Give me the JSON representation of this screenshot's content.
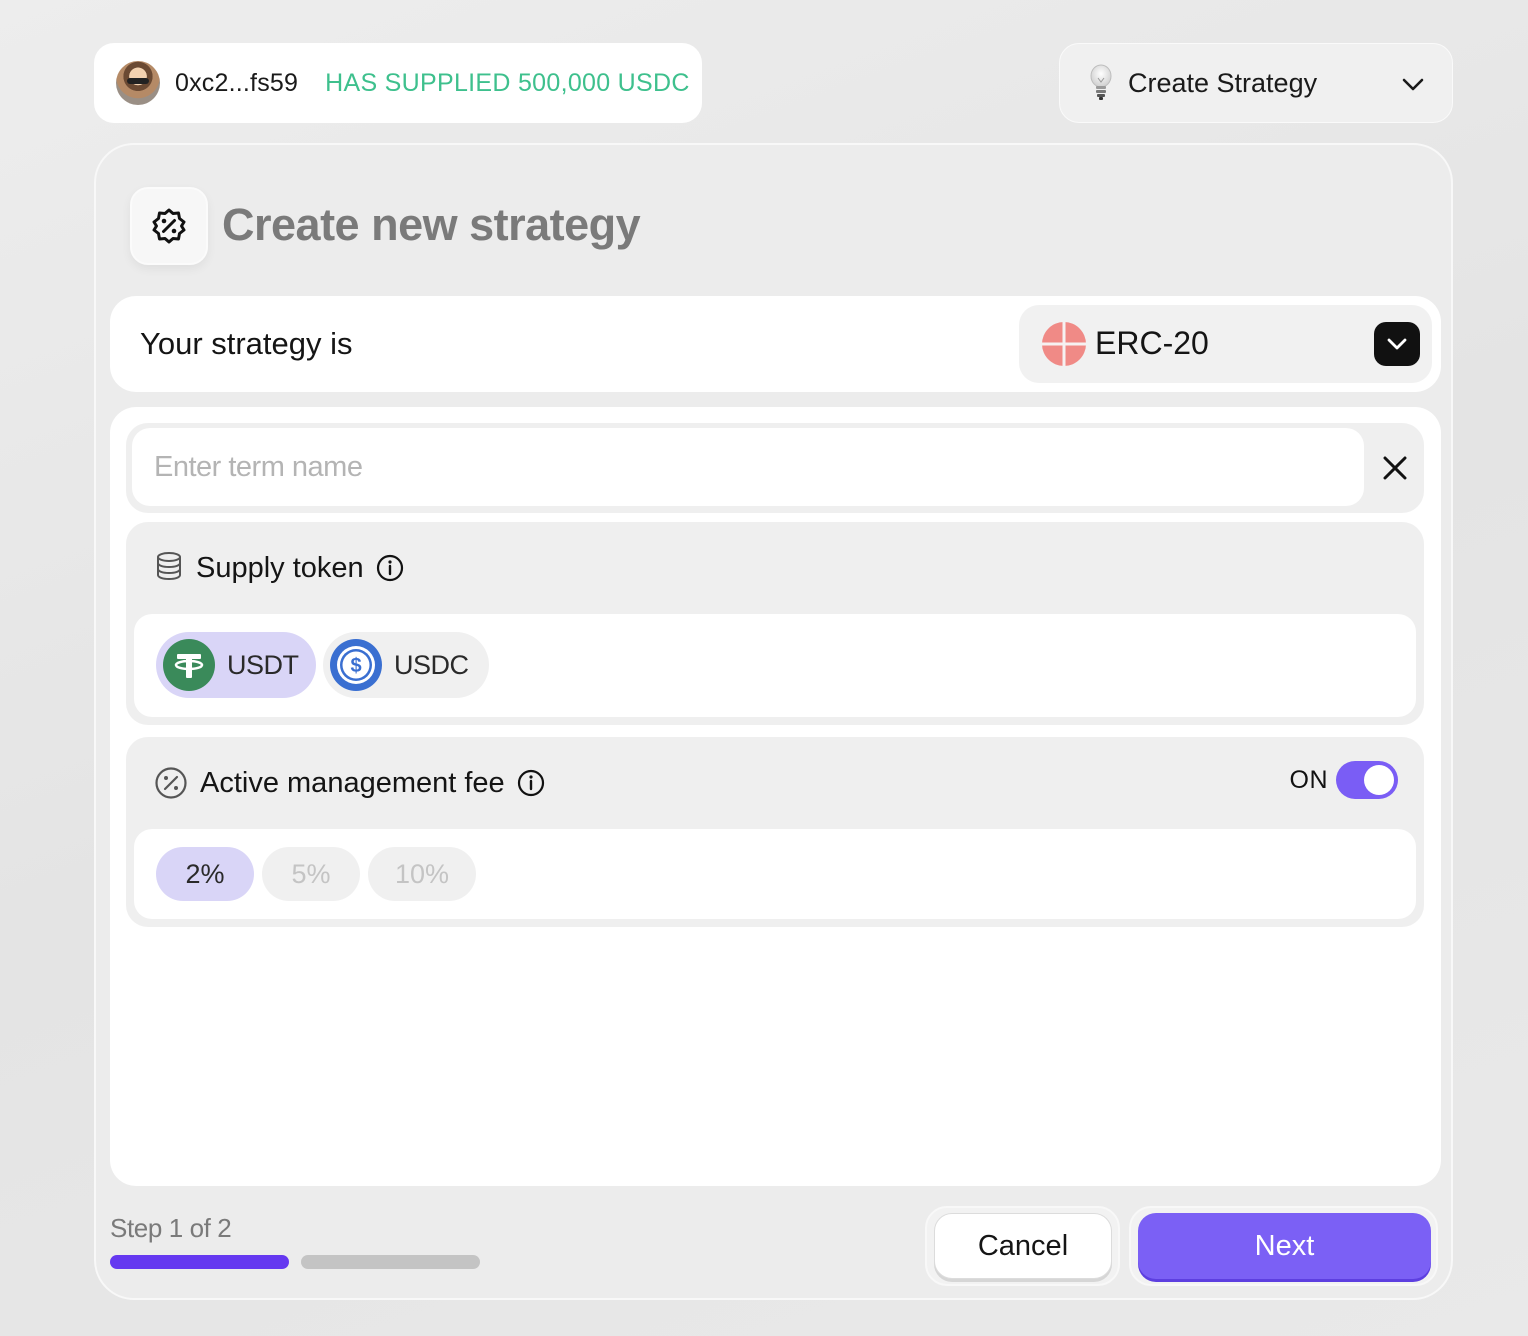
{
  "header": {
    "wallet_address": "0xc2...fs59",
    "supplied_text": "HAS SUPPLIED 500,000 USDC",
    "strategy_menu_label": "Create Strategy"
  },
  "panel": {
    "title": "Create new strategy",
    "strategy_is_label": "Your strategy is",
    "standard_value": "ERC-20"
  },
  "form": {
    "term_name_placeholder": "Enter term name",
    "term_name_value": "",
    "supply_token": {
      "title": "Supply token",
      "tokens": [
        {
          "label": "USDT",
          "selected": true,
          "icon": "tether-icon"
        },
        {
          "label": "USDC",
          "selected": false,
          "icon": "usdc-icon"
        }
      ]
    },
    "management_fee": {
      "title": "Active management fee",
      "toggle_label": "ON",
      "enabled": true,
      "options": [
        {
          "label": "2%",
          "selected": true
        },
        {
          "label": "5%",
          "selected": false
        },
        {
          "label": "10%",
          "selected": false
        }
      ]
    }
  },
  "footer": {
    "step_label": "Step 1 of 2",
    "current_step": 1,
    "total_steps": 2,
    "cancel_label": "Cancel",
    "next_label": "Next"
  },
  "colors": {
    "accent": "#7b60f5",
    "progress_active": "#6538f0",
    "success_text": "#3ec08d",
    "selected_chip": "#d9d5f7"
  }
}
